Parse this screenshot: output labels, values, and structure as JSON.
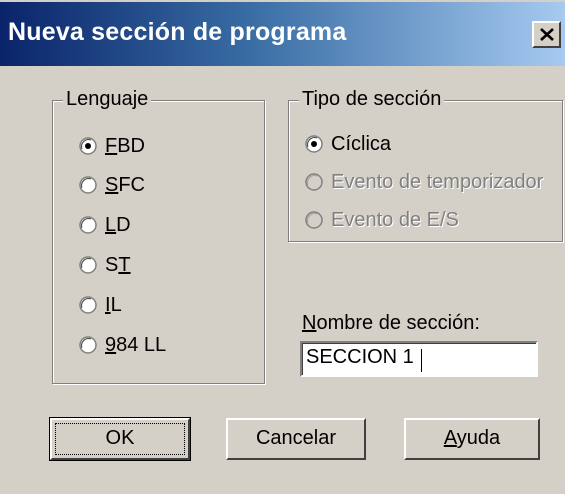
{
  "window": {
    "title": "Nueva sección de programa",
    "close_glyph": "×"
  },
  "lenguaje": {
    "label": "Lenguaje",
    "selected": "FBD",
    "options": [
      {
        "pre": "",
        "mn": "F",
        "post": "BD",
        "selected": true
      },
      {
        "pre": "",
        "mn": "S",
        "post": "FC",
        "selected": false
      },
      {
        "pre": "",
        "mn": "L",
        "post": "D",
        "selected": false
      },
      {
        "pre": "S",
        "mn": "T",
        "post": "",
        "selected": false
      },
      {
        "pre": "",
        "mn": "I",
        "post": "L",
        "selected": false
      },
      {
        "pre": "",
        "mn": "9",
        "post": "84 LL",
        "selected": false
      }
    ]
  },
  "tipo": {
    "label": "Tipo de sección",
    "options": [
      {
        "label": "Cíclica",
        "selected": true,
        "enabled": true
      },
      {
        "label": "Evento de temporizador",
        "selected": false,
        "enabled": false
      },
      {
        "label": "Evento de E/S",
        "selected": false,
        "enabled": false
      }
    ]
  },
  "nombre": {
    "label_mn": "N",
    "label_rest": "ombre de sección:",
    "value": "SECCION 1"
  },
  "buttons": {
    "ok": "OK",
    "cancel": "Cancelar",
    "help_mn": "A",
    "help_rest": "yuda"
  },
  "colors": {
    "title_start": "#0a246a",
    "title_end": "#a6caf0",
    "face": "#d4d0c8"
  }
}
